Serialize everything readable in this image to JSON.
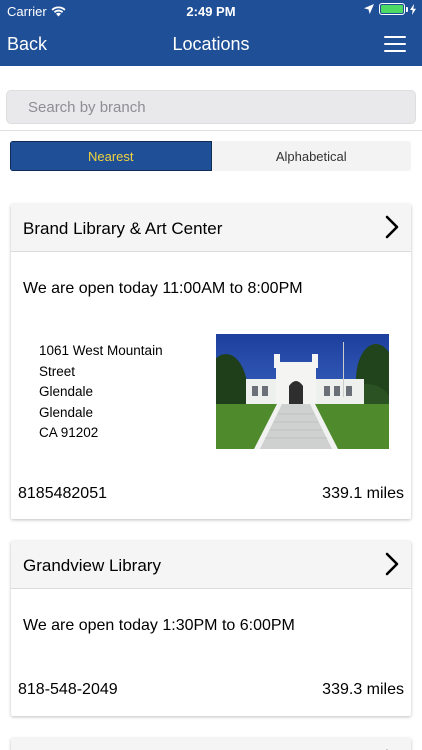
{
  "status": {
    "carrier": "Carrier",
    "time": "2:49 PM"
  },
  "nav": {
    "back": "Back",
    "title": "Locations"
  },
  "search": {
    "placeholder": "Search by branch"
  },
  "segments": {
    "nearest": "Nearest",
    "alphabetical": "Alphabetical"
  },
  "locations": [
    {
      "name": "Brand Library & Art Center",
      "hours": "We are open today 11:00AM to 8:00PM",
      "address": [
        "1061 West Mountain",
        "Street",
        "Glendale",
        "Glendale",
        "CA 91202"
      ],
      "phone": "8185482051",
      "distance": "339.1 miles"
    },
    {
      "name": "Grandview Library",
      "hours": "We are open today 1:30PM to 6:00PM",
      "phone": "818-548-2049",
      "distance": "339.3 miles"
    }
  ],
  "colors": {
    "accent": "#1f4f97",
    "selected_text": "#f2d33c"
  }
}
